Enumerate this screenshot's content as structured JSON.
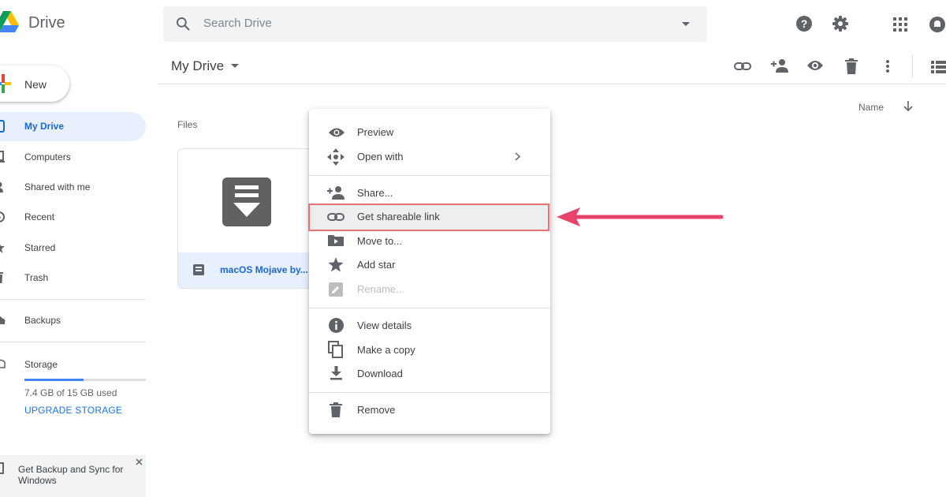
{
  "app": {
    "title": "Drive"
  },
  "search": {
    "placeholder": "Search Drive"
  },
  "sidebar": {
    "new_label": "New",
    "items": [
      {
        "label": "My Drive"
      },
      {
        "label": "Computers"
      },
      {
        "label": "Shared with me"
      },
      {
        "label": "Recent"
      },
      {
        "label": "Starred"
      },
      {
        "label": "Trash"
      },
      {
        "label": "Backups"
      },
      {
        "label": "Storage"
      }
    ],
    "storage_used": "7.4 GB of 15 GB used",
    "storage_fraction": 0.49,
    "upgrade_label": "UPGRADE STORAGE",
    "backup_promo": {
      "line1": "Get Backup and Sync for",
      "line2": "Windows"
    }
  },
  "main": {
    "title": "My Drive",
    "sort_label": "Name",
    "section_label": "Files",
    "file": {
      "name": "macOS Mojave by..."
    }
  },
  "context_menu": {
    "items": [
      {
        "label": "Preview"
      },
      {
        "label": "Open with"
      },
      {
        "label": "Share..."
      },
      {
        "label": "Get shareable link"
      },
      {
        "label": "Move to..."
      },
      {
        "label": "Add star"
      },
      {
        "label": "Rename..."
      },
      {
        "label": "View details"
      },
      {
        "label": "Make a copy"
      },
      {
        "label": "Download"
      },
      {
        "label": "Remove"
      }
    ]
  },
  "colors": {
    "accent": "#1a73e8",
    "active_nav_bg": "#e8f0fe",
    "arrow": "#e8436a",
    "highlight_border": "#e57373"
  }
}
